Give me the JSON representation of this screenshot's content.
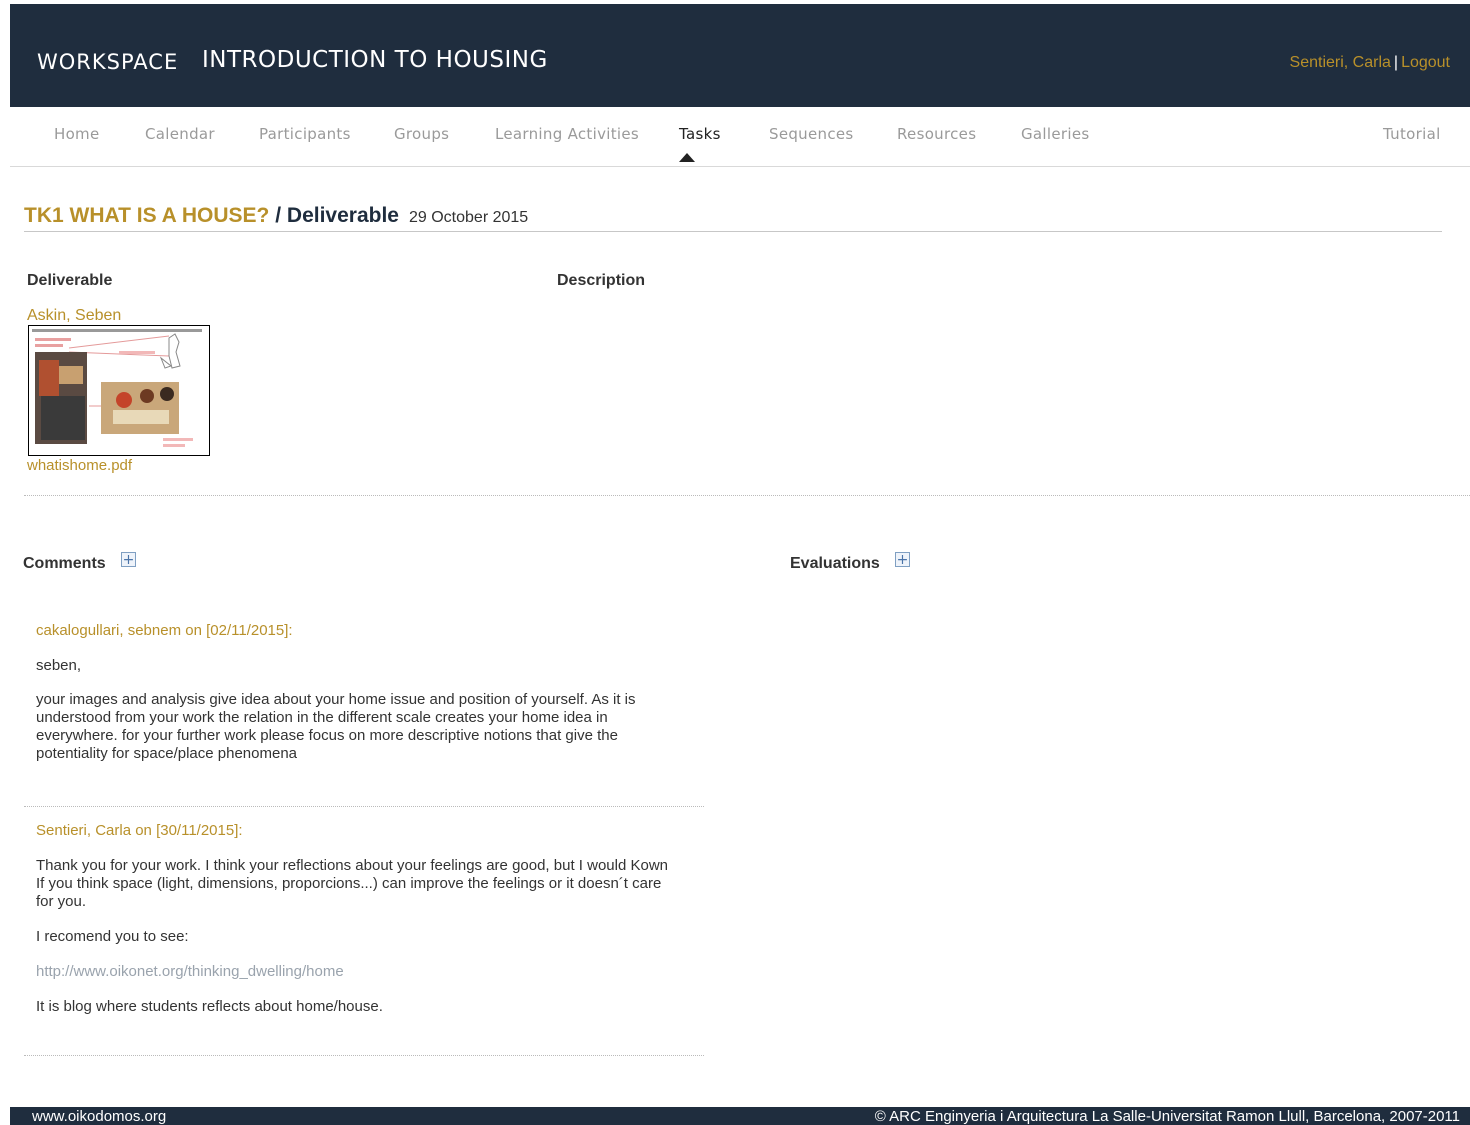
{
  "header": {
    "workspace": "WORKSPACE",
    "course": "INTRODUCTION TO HOUSING",
    "user": "Sentieri, Carla",
    "separator": "|",
    "logout": "Logout"
  },
  "nav": {
    "items": [
      "Home",
      "Calendar",
      "Participants",
      "Groups",
      "Learning Activities",
      "Tasks",
      "Sequences",
      "Resources",
      "Galleries"
    ],
    "tutorial": "Tutorial",
    "active": "Tasks"
  },
  "title": {
    "task": "TK1 WHAT IS A HOUSE?",
    "slash": " / ",
    "section": "Deliverable",
    "date": "29 October 2015"
  },
  "deliverable": {
    "col_deliverable": "Deliverable",
    "col_description": "Description",
    "author": "Askin, Seben",
    "file": "whatishome.pdf"
  },
  "comments": {
    "heading": "Comments",
    "items": [
      {
        "author": "cakalogullari, sebnem",
        "on": "on",
        "date": "[02/11/2015]",
        "colon": ":",
        "paragraphs": [
          "seben,",
          "your images and analysis give idea about your home issue and position of yourself. As it is understood from your work the relation in the different scale creates your home idea in everywhere. for your further work please focus on more descriptive notions that give the potentiality for space/place phenomena"
        ]
      },
      {
        "author": "Sentieri, Carla",
        "on": "on",
        "date": "[30/11/2015]",
        "colon": ":",
        "paragraphs": [
          "Thank you for your work. I think your reflections about your feelings are good, but I would Kown If you think space (light, dimensions, proporcions...) can improve the feelings or it doesn´t care for you.",
          "I recomend you to see:",
          "http://www.oikonet.org/thinking_dwelling/home",
          "It is blog where students reflects about home/house."
        ]
      }
    ]
  },
  "evaluations": {
    "heading": "Evaluations"
  },
  "footer": {
    "left": "www.oikodomos.org",
    "right": "© ARC Enginyeria i Arquitectura La Salle-Universitat Ramon Llull, Barcelona, 2007-2011"
  },
  "colors": {
    "header_bg": "#1f2d3e",
    "accent_gold": "#b8902a"
  },
  "icons": {
    "add": "plus-icon",
    "active_tab": "caret-up-icon"
  }
}
